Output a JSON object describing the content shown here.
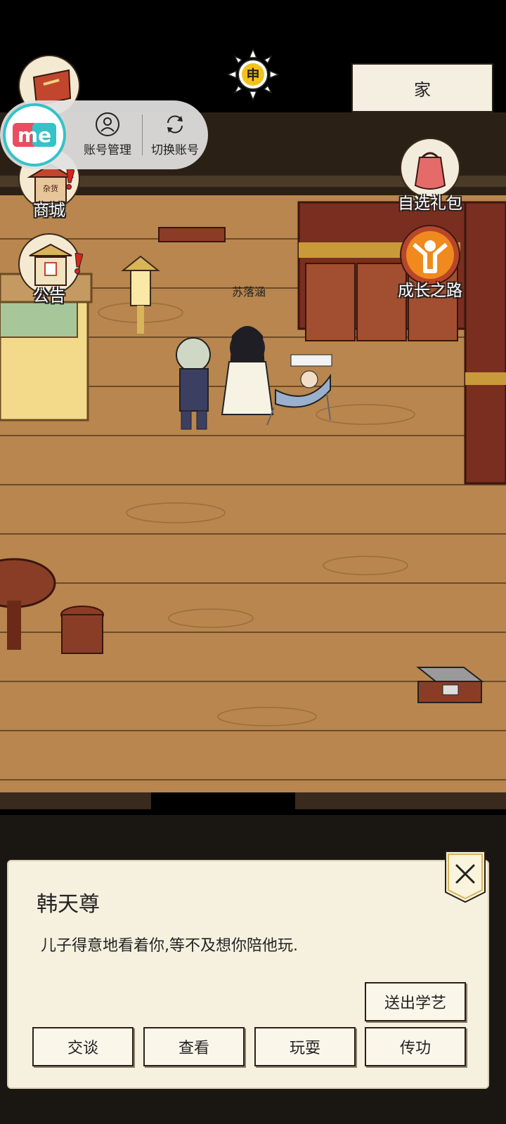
{
  "header": {
    "time_badge": "申",
    "location": "家"
  },
  "overlay": {
    "logo": "me",
    "account_manage": "账号管理",
    "switch_account": "切换账号"
  },
  "left_menu": [
    {
      "label": "商城",
      "badge": "杂货",
      "icon": "shop-icon"
    },
    {
      "label": "公告",
      "icon": "notice-icon"
    }
  ],
  "right_menu": [
    {
      "label": "自选礼包",
      "icon": "gift-bag-icon"
    },
    {
      "label": "成长之路",
      "icon": "growth-path-icon"
    }
  ],
  "scene": {
    "npc_name": "苏落涵"
  },
  "dialog": {
    "title": "韩天尊",
    "text": "儿子得意地看着你,等不及想你陪他玩.",
    "buttons": {
      "send_learn": "送出学艺",
      "talk": "交谈",
      "view": "查看",
      "play": "玩耍",
      "teach": "传功"
    }
  },
  "colors": {
    "floor": "#b8864e",
    "dialog_bg": "#f6f0df",
    "me_accent": "#33c3c9"
  }
}
